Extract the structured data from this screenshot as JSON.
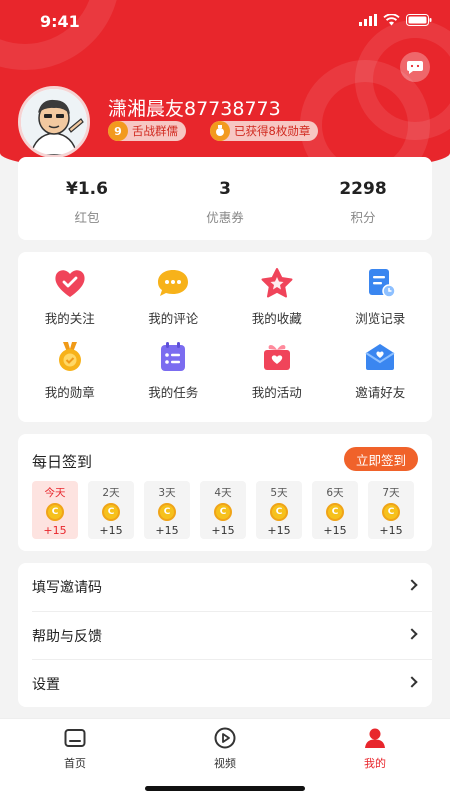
{
  "status": {
    "time": "9:41"
  },
  "profile": {
    "username": "潇湘晨友87738773",
    "badges": [
      {
        "icon_text": "9",
        "label": "舌战群儒"
      },
      {
        "icon_text": "",
        "label": "已获得8枚勋章"
      }
    ]
  },
  "stats": [
    {
      "value": "¥1.6",
      "label": "红包"
    },
    {
      "value": "3",
      "label": "优惠券"
    },
    {
      "value": "2298",
      "label": "积分"
    }
  ],
  "features": [
    {
      "label": "我的关注",
      "icon": "heart-icon",
      "color": "#f0445a"
    },
    {
      "label": "我的评论",
      "icon": "comment-icon",
      "color": "#f7b21a"
    },
    {
      "label": "我的收藏",
      "icon": "star-icon",
      "color": "#f0445a"
    },
    {
      "label": "浏览记录",
      "icon": "history-icon",
      "color": "#3a86f0"
    },
    {
      "label": "我的勋章",
      "icon": "medal-icon",
      "color": "#f7b21a"
    },
    {
      "label": "我的任务",
      "icon": "task-icon",
      "color": "#7b6cf0"
    },
    {
      "label": "我的活动",
      "icon": "gift-icon",
      "color": "#f0445a"
    },
    {
      "label": "邀请好友",
      "icon": "invite-icon",
      "color": "#3a86f0"
    }
  ],
  "signin": {
    "title": "每日签到",
    "button": "立即签到",
    "days": [
      {
        "label": "今天",
        "points": "+15"
      },
      {
        "label": "2天",
        "points": "+15"
      },
      {
        "label": "3天",
        "points": "+15"
      },
      {
        "label": "4天",
        "points": "+15"
      },
      {
        "label": "5天",
        "points": "+15"
      },
      {
        "label": "6天",
        "points": "+15"
      },
      {
        "label": "7天",
        "points": "+15"
      }
    ]
  },
  "menu": [
    {
      "label": "填写邀请码"
    },
    {
      "label": "帮助与反馈"
    },
    {
      "label": "设置"
    }
  ],
  "tabs": [
    {
      "label": "首页",
      "icon": "home-icon"
    },
    {
      "label": "视频",
      "icon": "video-icon"
    },
    {
      "label": "我的",
      "icon": "profile-icon",
      "active": true
    }
  ],
  "colors": {
    "brand_red": "#e8262c",
    "signin_orange": "#f0622a",
    "coin_gold": "#f6c11c"
  }
}
